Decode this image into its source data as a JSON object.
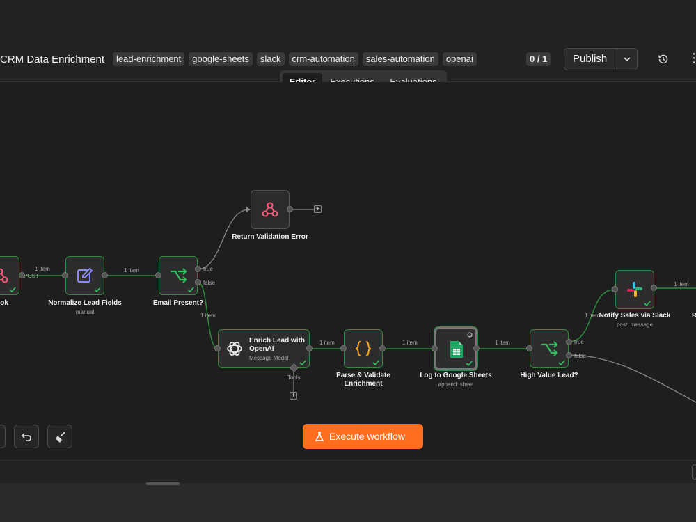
{
  "header": {
    "workflow_title": "CRM Data Enrichment",
    "tags": [
      "lead-enrichment",
      "google-sheets",
      "slack",
      "crm-automation",
      "sales-automation",
      "openai"
    ],
    "counter": "0 / 1",
    "publish_label": "Publish",
    "more_glyph": "⋮"
  },
  "tabs": [
    {
      "label": "Editor",
      "active": true
    },
    {
      "label": "Executions",
      "active": false
    },
    {
      "label": "Evaluations",
      "active": false
    }
  ],
  "nodes": {
    "webhook": {
      "label": "hook",
      "icon": "webhook-icon"
    },
    "normalize": {
      "label": "Normalize Lead Fields",
      "sub": "manual",
      "icon": "pencil-icon"
    },
    "email_present": {
      "label": "Email Present?",
      "icon": "branch-icon"
    },
    "return_error": {
      "label": "Return Validation Error",
      "icon": "webhook-icon"
    },
    "enrich": {
      "label_line1": "Enrich Lead with",
      "label_line2": "OpenAI",
      "sub": "Message Model",
      "icon": "openai-icon"
    },
    "parse": {
      "label_line1": "Parse & Validate",
      "label_line2": "Enrichment",
      "icon": "code-braces-icon"
    },
    "sheets": {
      "label": "Log to Google Sheets",
      "sub": "append: sheet",
      "icon": "google-sheets-icon"
    },
    "high_value": {
      "label": "High Value Lead?",
      "icon": "branch-icon"
    },
    "slack": {
      "label": "Notify Sales via Slack",
      "sub": "post: message",
      "icon": "slack-icon"
    },
    "cut_right_label": "R"
  },
  "edges": {
    "post_label": "POST",
    "item_label": "1 item",
    "true_label": "true",
    "false_label": "false",
    "tools_label": "Tools",
    "plus_glyph": "+"
  },
  "footer": {
    "execute_label": "Execute workflow"
  },
  "colors": {
    "accent": "#ff6d1f",
    "success": "#2e8b3e",
    "webhook": "#ff5a7a",
    "branch": "#32c15e",
    "pencil": "#7c7cff",
    "braces": "#f5a623",
    "sheets": "#1fa463"
  }
}
